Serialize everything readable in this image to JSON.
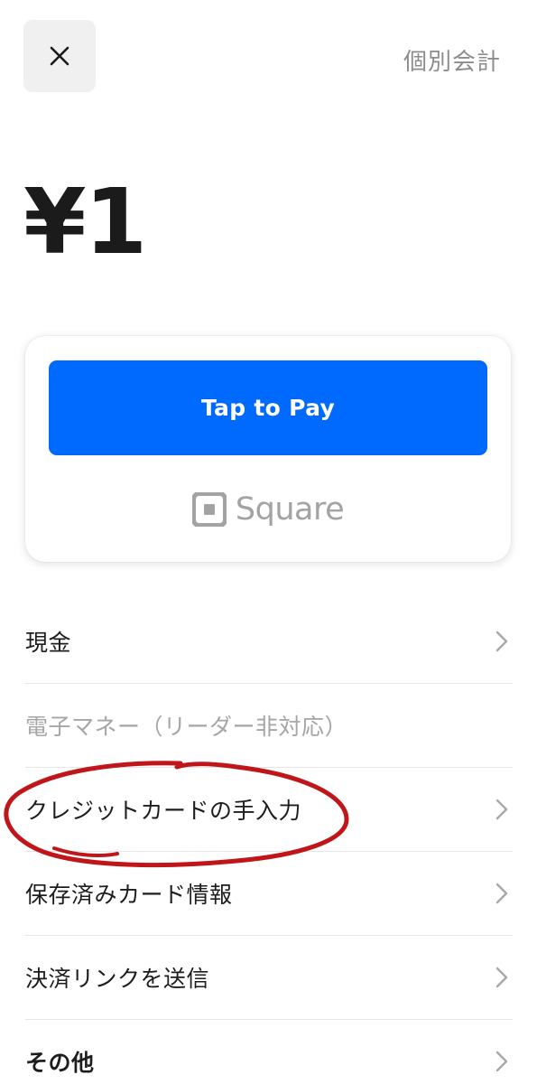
{
  "header": {
    "close_icon": "close-icon",
    "split_label": "個別会計"
  },
  "amount": {
    "value": "¥1"
  },
  "payment_card": {
    "tap_to_pay_label": "Tap to Pay",
    "brand_name": "Square",
    "brand_icon": "square-logo-icon",
    "colors": {
      "button": "#006aff",
      "brand": "#a3a3a3"
    }
  },
  "menu": {
    "items": [
      {
        "label": "現金",
        "enabled": true,
        "chevron": true
      },
      {
        "label": "電子マネー（リーダー非対応）",
        "enabled": false,
        "chevron": false
      },
      {
        "label": "クレジットカードの手入力",
        "enabled": true,
        "chevron": true,
        "annotated": true
      },
      {
        "label": "保存済みカード情報",
        "enabled": true,
        "chevron": true
      },
      {
        "label": "決済リンクを送信",
        "enabled": true,
        "chevron": true
      },
      {
        "label": "その他",
        "enabled": true,
        "chevron": true,
        "bold": true
      }
    ]
  },
  "annotation": {
    "color": "#c0161a",
    "shape": "hand-drawn-ellipse"
  }
}
